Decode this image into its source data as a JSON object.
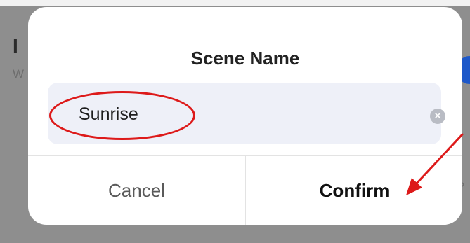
{
  "background": {
    "heading_fragment": "I",
    "sub_fragment": "W",
    "chevron": "›"
  },
  "dialog": {
    "title": "Scene Name",
    "name_field": {
      "value": "Sunrise",
      "clear_icon": "×"
    },
    "cancel_label": "Cancel",
    "confirm_label": "Confirm"
  },
  "annotations": {
    "color": "#dd1a1a"
  }
}
